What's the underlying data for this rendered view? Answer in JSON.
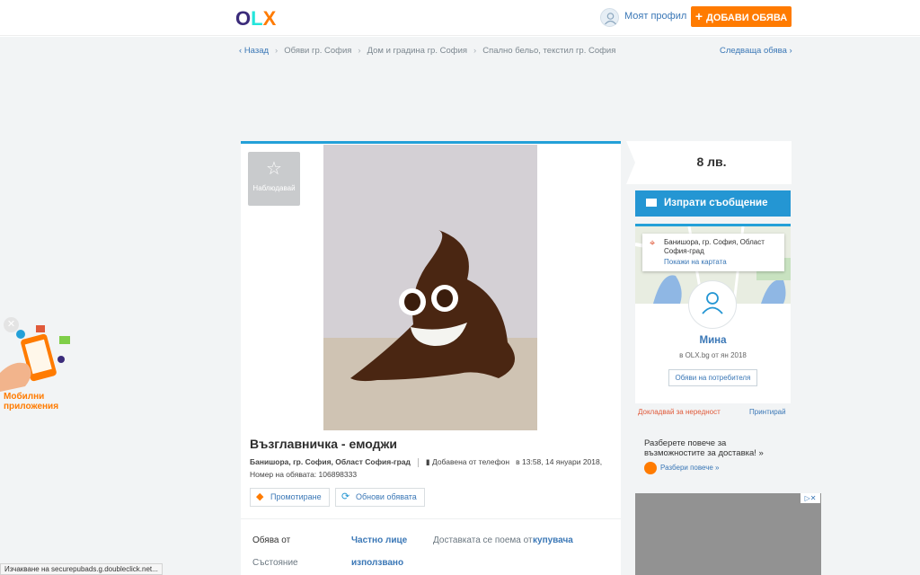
{
  "header": {
    "logo": {
      "o": "O",
      "l": "L",
      "x": "X"
    },
    "profile_label": "Моят профил",
    "add_button": "ДОБАВИ ОБЯВА",
    "add_icon": "+"
  },
  "breadcrumb": {
    "back": "Назад",
    "items": [
      "Обяви гр. София",
      "Дом и градина гр. София",
      "Спално бельо, текстил гр. София"
    ],
    "next": "Следваща обява"
  },
  "ad": {
    "follow_label": "Наблюдавай",
    "title": "Възглавничка - емоджи",
    "location": "Банишора, гр. София, Област София-град",
    "posted": "Добавена от телефон",
    "posted_at": "в 13:58, 14 януари 2018,",
    "ad_number": "Номер на обявата: 106898333",
    "promote": "Промотиране",
    "refresh": "Обнови обявата",
    "details": [
      {
        "label": "Обява от",
        "value": "Частно лице"
      },
      {
        "label": "Доставката се поема от",
        "value": "купувача"
      },
      {
        "label": "Състояние",
        "value": "използвано"
      }
    ]
  },
  "sidebar": {
    "price": "8 лв.",
    "message_button": "Изпрати съобщение",
    "map_location": "Банишора, гр. София, Област София-град",
    "show_on_map": "Покажи на картата",
    "seller_name": "Мина",
    "seller_since": "в OLX.bg от ян 2018",
    "user_ads": "Обяви на потребителя",
    "report": "Докладвай за нередност",
    "print": "Принтирай",
    "delivery_text": "Разберете повече за възможностите за доставка! »",
    "delivery_link": "Разбери повече »"
  },
  "promo": {
    "text": "Мобилни приложения"
  },
  "status_bar": "Изчакване на securepubads.g.doubleclick.net...",
  "colors": {
    "accent": "#ff7b00",
    "link": "#3a77b6",
    "blue": "#2496d3",
    "background": "#f2f4f5"
  },
  "icons": [
    "user-icon",
    "plus-icon",
    "chevron-left-icon",
    "chevron-right-icon",
    "star-icon",
    "phone-icon",
    "kite-icon",
    "refresh-icon",
    "envelope-icon",
    "map-pin-icon",
    "close-icon",
    "truck-icon"
  ]
}
